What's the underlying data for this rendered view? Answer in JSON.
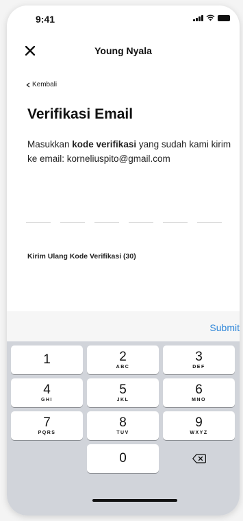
{
  "status": {
    "time": "9:41"
  },
  "header": {
    "title": "Young Nyala"
  },
  "back": {
    "label": "Kembali"
  },
  "verification": {
    "title": "Verifikasi Email",
    "instruction_prefix": "Masukkan ",
    "instruction_bold": "kode verifikasi",
    "instruction_suffix": " yang sudah kami kirim ke email: korneliuspito@gmail.com",
    "resend_label": "Kirim Ulang Kode Verifikasi (30)"
  },
  "keyboard": {
    "submit_label": "Submit",
    "keys": [
      {
        "num": "1",
        "letters": ""
      },
      {
        "num": "2",
        "letters": "ABC"
      },
      {
        "num": "3",
        "letters": "DEF"
      },
      {
        "num": "4",
        "letters": "GHI"
      },
      {
        "num": "5",
        "letters": "JKL"
      },
      {
        "num": "6",
        "letters": "MNO"
      },
      {
        "num": "7",
        "letters": "PQRS"
      },
      {
        "num": "8",
        "letters": "TUV"
      },
      {
        "num": "9",
        "letters": "WXYZ"
      },
      {
        "num": "0",
        "letters": ""
      }
    ],
    "delete_icon": "backspace-icon"
  },
  "colors": {
    "accent": "#2e86d9",
    "keyboard_bg": "#d1d4da"
  }
}
